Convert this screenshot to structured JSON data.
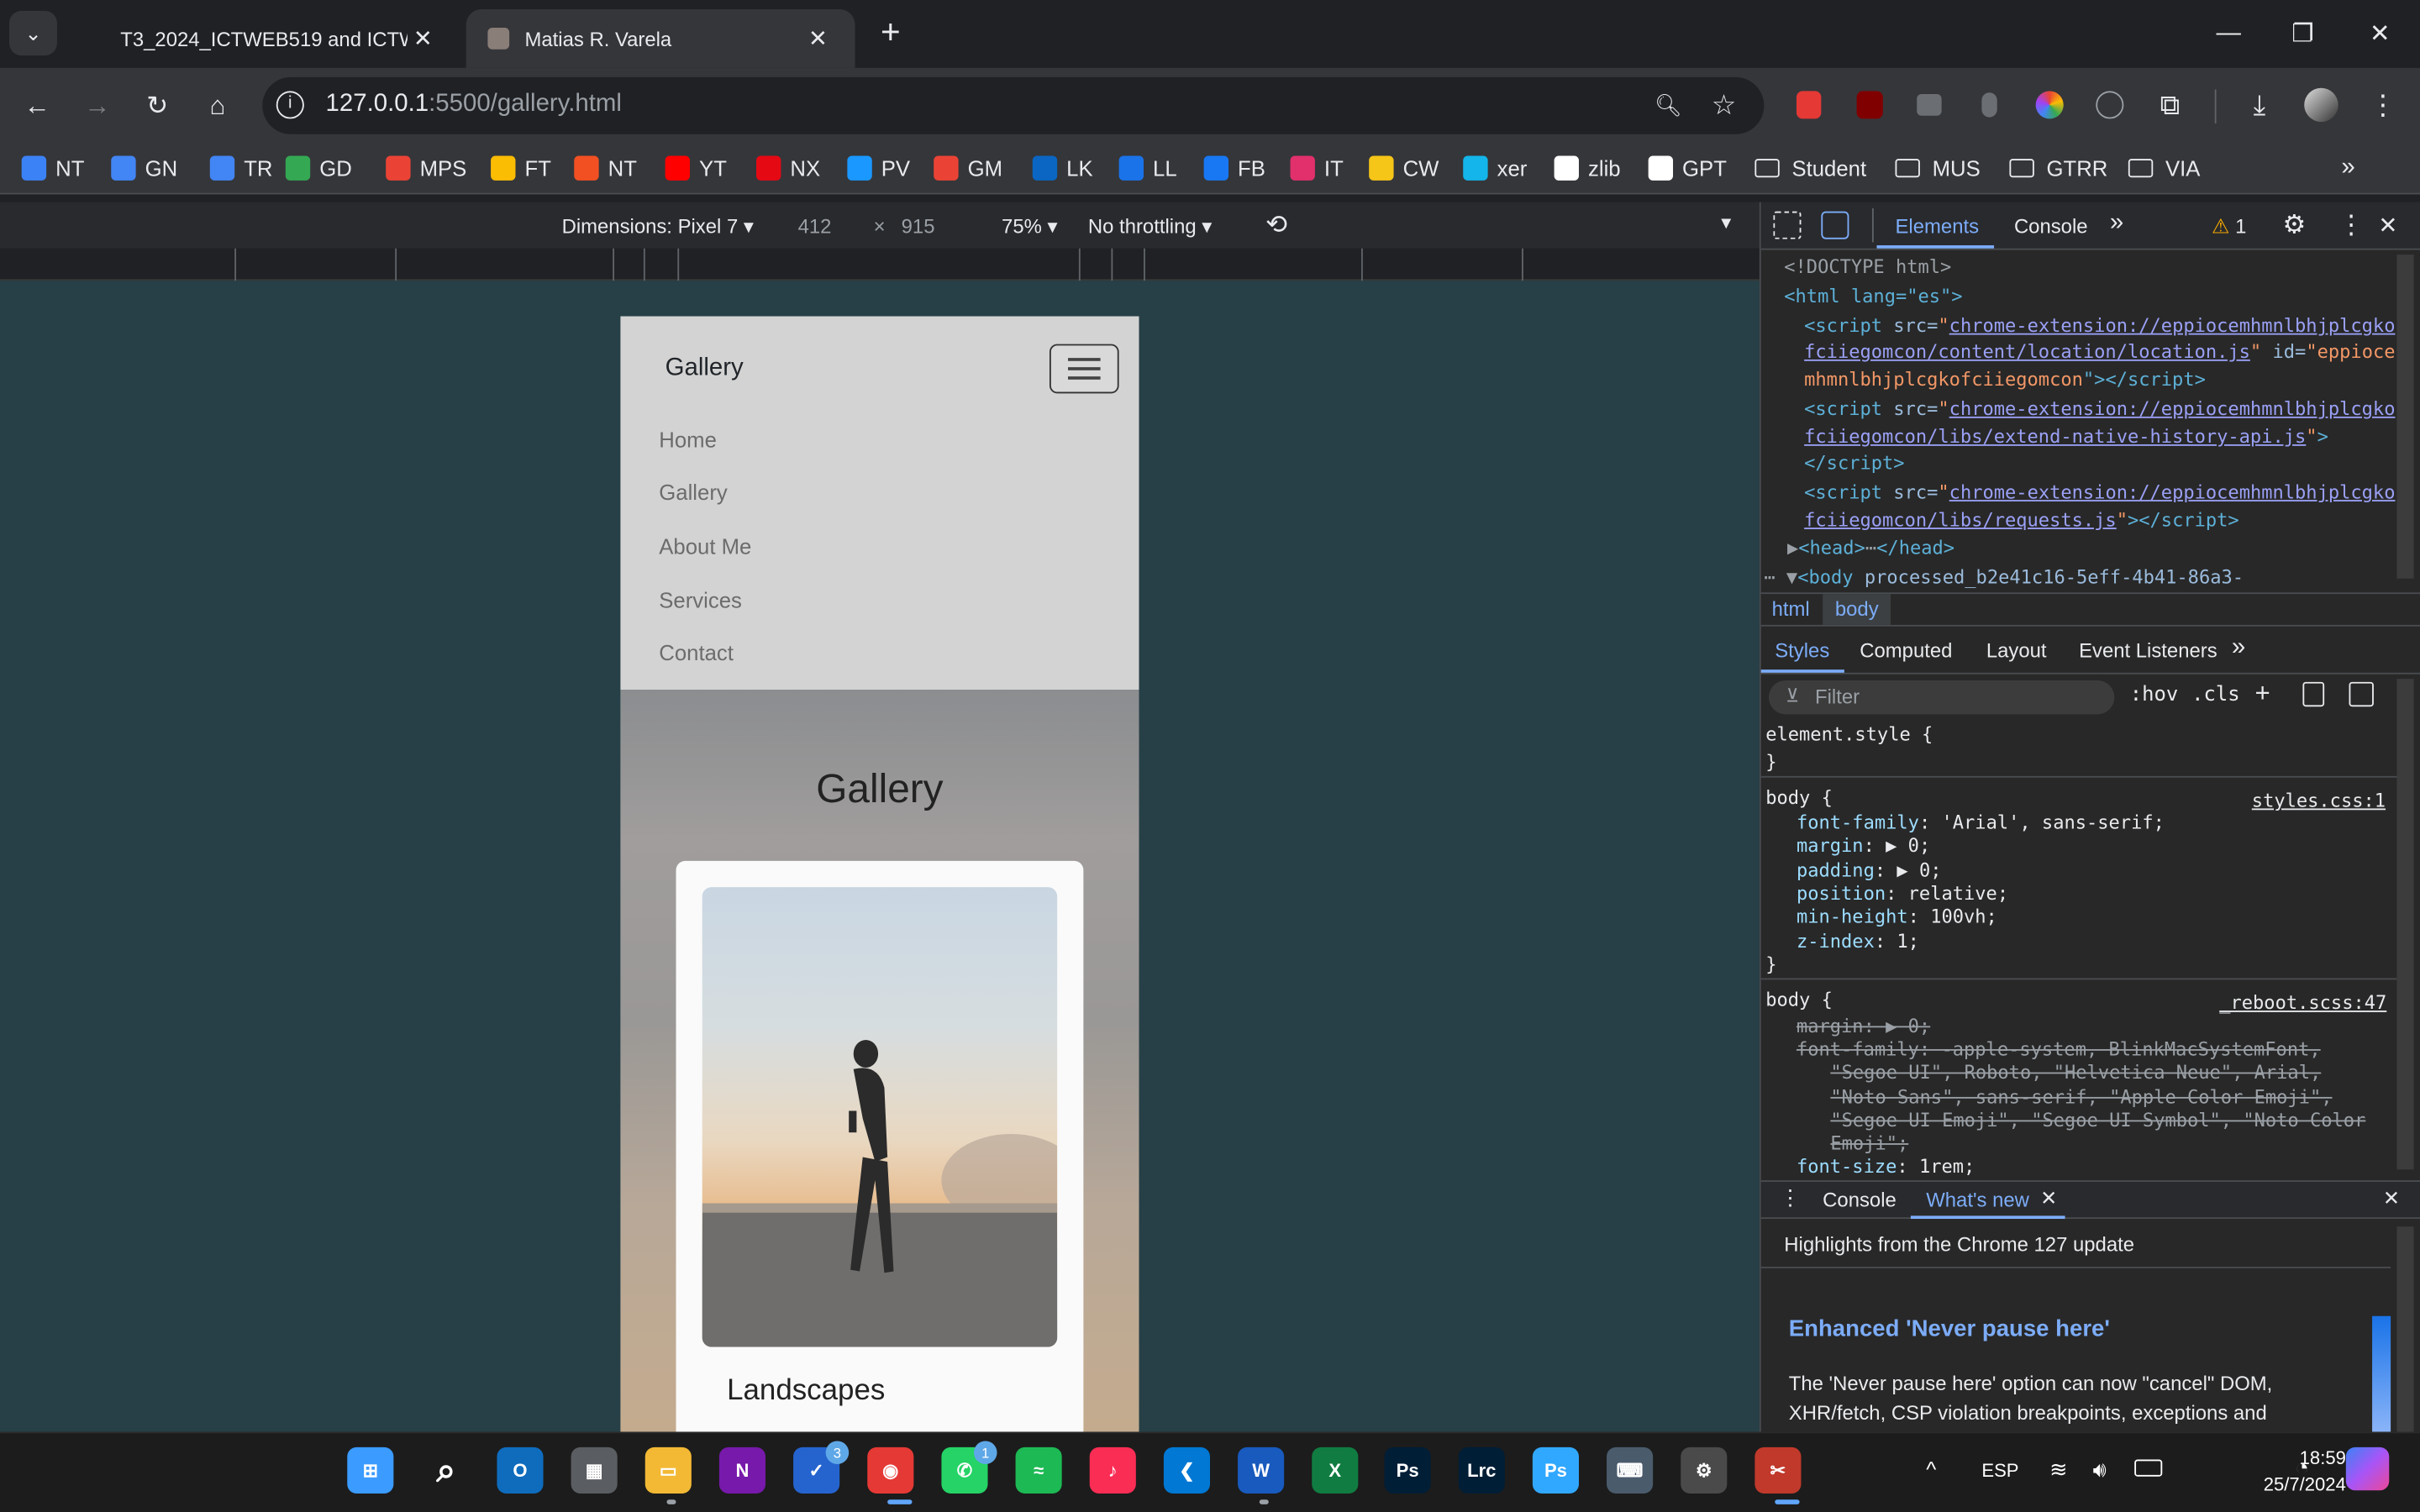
{
  "browser": {
    "tabs": [
      {
        "title": "T3_2024_ICTWEB519 and ICTWEB",
        "active": false
      },
      {
        "title": "Matias R. Varela",
        "active": true
      }
    ],
    "new_tab_symbol": "+",
    "url_host": "127.0.0.1",
    "url_path": ":5500/gallery.html",
    "bookmarks": [
      {
        "label": "NT",
        "icon": "checkmark-icon",
        "color": "#3b82f6"
      },
      {
        "label": "GN",
        "icon": "google-news-icon",
        "color": "#4285f4"
      },
      {
        "label": "TR",
        "icon": "translate-icon",
        "color": "#4285f4"
      },
      {
        "label": "GD",
        "icon": "drive-icon",
        "color": "#34a853"
      },
      {
        "label": "MPS",
        "icon": "maps-icon",
        "color": "#ea4335"
      },
      {
        "label": "FT",
        "icon": "photos-icon",
        "color": "#fbbc04"
      },
      {
        "label": "NT",
        "icon": "windows-icon",
        "color": "#f25022"
      },
      {
        "label": "YT",
        "icon": "youtube-icon",
        "color": "#ff0000"
      },
      {
        "label": "NX",
        "icon": "netflix-icon",
        "color": "#e50914"
      },
      {
        "label": "PV",
        "icon": "prime-video-icon",
        "color": "#1a98ff"
      },
      {
        "label": "GM",
        "icon": "gmail-icon",
        "color": "#ea4335"
      },
      {
        "label": "LK",
        "icon": "linkedin-icon",
        "color": "#0a66c2"
      },
      {
        "label": "LL",
        "icon": "play-icon",
        "color": "#1a73e8"
      },
      {
        "label": "FB",
        "icon": "facebook-icon",
        "color": "#1877f2"
      },
      {
        "label": "IT",
        "icon": "instagram-icon",
        "color": "#e1306c"
      },
      {
        "label": "CW",
        "icon": "diamond-icon",
        "color": "#f5c518"
      },
      {
        "label": "xer",
        "icon": "xero-icon",
        "color": "#13b5ea"
      },
      {
        "label": "zlib",
        "icon": "zlib-icon",
        "color": "#ffffff"
      },
      {
        "label": "GPT",
        "icon": "chatgpt-icon",
        "color": "#ffffff"
      }
    ],
    "bookmark_folders": [
      "Student",
      "MUS",
      "GTRR",
      "VIA"
    ]
  },
  "device_toolbar": {
    "dimensions": "Dimensions: Pixel 7",
    "width": "412",
    "times": "×",
    "height": "915",
    "zoom": "75%",
    "throttling": "No throttling"
  },
  "site": {
    "brand": "Gallery",
    "nav_links": [
      "Home",
      "Gallery",
      "About Me",
      "Services",
      "Contact"
    ],
    "section_title": "Gallery",
    "card_title": "Landscapes"
  },
  "devtools": {
    "tabs": [
      "Elements",
      "Console"
    ],
    "more": "»",
    "warnings": "1",
    "dom_lines": [
      "<!DOCTYPE html>",
      "<html lang=\"es\">",
      "chrome-extension://eppiocemhmnlbhjplcgkofciiegomcon/content/location/location.js",
      "mhmnlbhjplcgkofciiegomcon",
      "chrome-extension://eppiocemhmnlbhjplcgkofciiegomcon/libs/extend-native-history-api.js",
      "chrome-extension://eppiocemhmnlbhjplcgkofciiegomcon/libs/requests.js",
      "processed_b2e41c16-5eff-4b41-86a3-"
    ],
    "breadcrumbs": [
      "html",
      "body"
    ],
    "subtabs": [
      "Styles",
      "Computed",
      "Layout",
      "Event Listeners"
    ],
    "filter_placeholder": "Filter",
    "hov": ":hov",
    "cls": ".cls",
    "rule1_source": "styles.css:1",
    "rule2_source": "_reboot.scss:47",
    "rule1_props": [
      [
        "font-family",
        "'Arial', sans-serif;"
      ],
      [
        "margin",
        "▶ 0;"
      ],
      [
        "padding",
        "▶ 0;"
      ],
      [
        "position",
        "relative;"
      ],
      [
        "min-height",
        "100vh;"
      ],
      [
        "z-index",
        "1;"
      ]
    ],
    "drawer_tabs": [
      "Console",
      "What's new"
    ],
    "whats_new_header": "Highlights from the Chrome 127 update",
    "whats_new_title": "Enhanced 'Never pause here'",
    "whats_new_body": "The 'Never pause here' option can now \"cancel\" DOM, XHR/fetch, CSP violation breakpoints, exceptions and"
  },
  "taskbar": {
    "language": "ESP",
    "time": "18:59",
    "date": "25/7/2024",
    "badge_todo": "3",
    "badge_whatsapp": "1"
  }
}
